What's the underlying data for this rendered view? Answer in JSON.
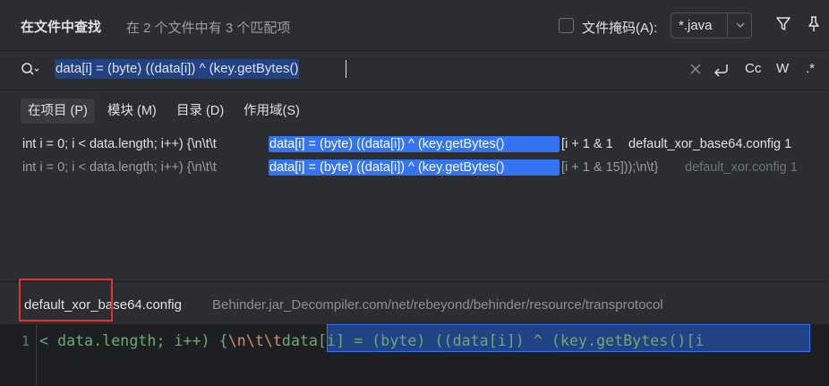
{
  "header": {
    "title": "在文件中查找",
    "match_summary": "在 2 个文件中有 3 个匹配项",
    "file_mask_label": "文件掩码(A):",
    "file_mask_value": "*.java",
    "file_mask_checked": false
  },
  "search": {
    "query": "data[i] = (byte) ((data[i]) ^ (key.getBytes()",
    "options": {
      "match_case": "Cc",
      "words": "W",
      "regex": ".*"
    }
  },
  "scopes": [
    {
      "label": "在项目 (P)",
      "active": true
    },
    {
      "label": "模块 (M)",
      "active": false
    },
    {
      "label": "目录 (D)",
      "active": false
    },
    {
      "label": "作用域(S)",
      "active": false
    }
  ],
  "results": [
    {
      "prefix": "int i = 0; i < data.length; i++) {\\n\\t\\t",
      "match": "data[i] = (byte) ((data[i]) ^ (key.getBytes()",
      "suffix": "[i + 1 & 1",
      "file": "default_xor_base64.config 1"
    },
    {
      "prefix": "int i = 0; i < data.length; i++) {\\n\\t\\t",
      "match": "data[i] = (byte) ((data[i]) ^ (key.getBytes()",
      "suffix": "[i + 1 & 15]));\\n\\t}",
      "file": "default_xor.config 1"
    }
  ],
  "preview": {
    "file_name": "default_xor_base64.config",
    "path": "Behinder.jar_Decompiler.com/net/rebeyond/behinder/resource/transprotocol",
    "line_number": "1",
    "code_before": "< data.length; i++) {",
    "code_escape": "\\n\\t\\t",
    "code_match": "data[i] = (byte) ((data[i]) ^ (key.getBytes()[i"
  },
  "colors": {
    "background": "#2b2d30",
    "selection": "#3574f0",
    "annotation": "#e5302f"
  }
}
